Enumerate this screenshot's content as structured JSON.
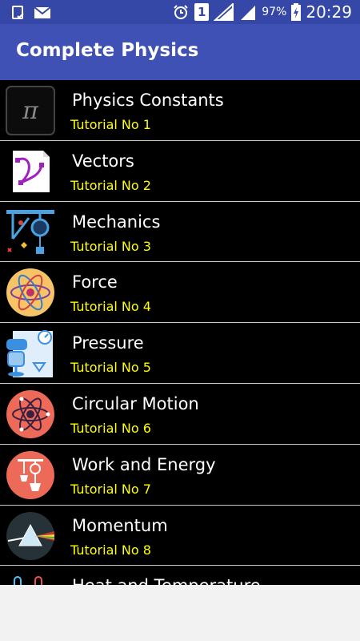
{
  "status_bar": {
    "battery_percent": "97%",
    "time": "20:29",
    "sim_badge": "1",
    "icons": [
      "clipboard-check-icon",
      "gmail-icon",
      "alarm-icon",
      "sim-1-icon",
      "signal-icon",
      "signal-icon",
      "battery-charging-icon"
    ]
  },
  "app_bar": {
    "title": "Complete Physics"
  },
  "colors": {
    "status_bar": "#3547a7",
    "app_bar": "#3f51b5",
    "list_bg": "#000000",
    "subtitle": "#ffff00",
    "title": "#ffffff"
  },
  "list": {
    "items": [
      {
        "title": "Physics Constants",
        "subtitle": "Tutorial No 1",
        "icon": "pi-icon"
      },
      {
        "title": "Vectors",
        "subtitle": "Tutorial No 2",
        "icon": "vector-curve-icon"
      },
      {
        "title": "Mechanics",
        "subtitle": "Tutorial No 3",
        "icon": "pulley-icon"
      },
      {
        "title": "Force",
        "subtitle": "Tutorial No 4",
        "icon": "atom-icon"
      },
      {
        "title": "Pressure",
        "subtitle": "Tutorial No 5",
        "icon": "pressure-gauge-icon"
      },
      {
        "title": "Circular Motion",
        "subtitle": "Tutorial No 6",
        "icon": "atom-orbit-icon"
      },
      {
        "title": "Work and Energy",
        "subtitle": "Tutorial No 7",
        "icon": "pulley-weight-icon"
      },
      {
        "title": "Momentum",
        "subtitle": "Tutorial No 8",
        "icon": "prism-icon"
      },
      {
        "title": "Heat and Temperature",
        "subtitle": "",
        "icon": "thermometer-icon"
      }
    ]
  }
}
